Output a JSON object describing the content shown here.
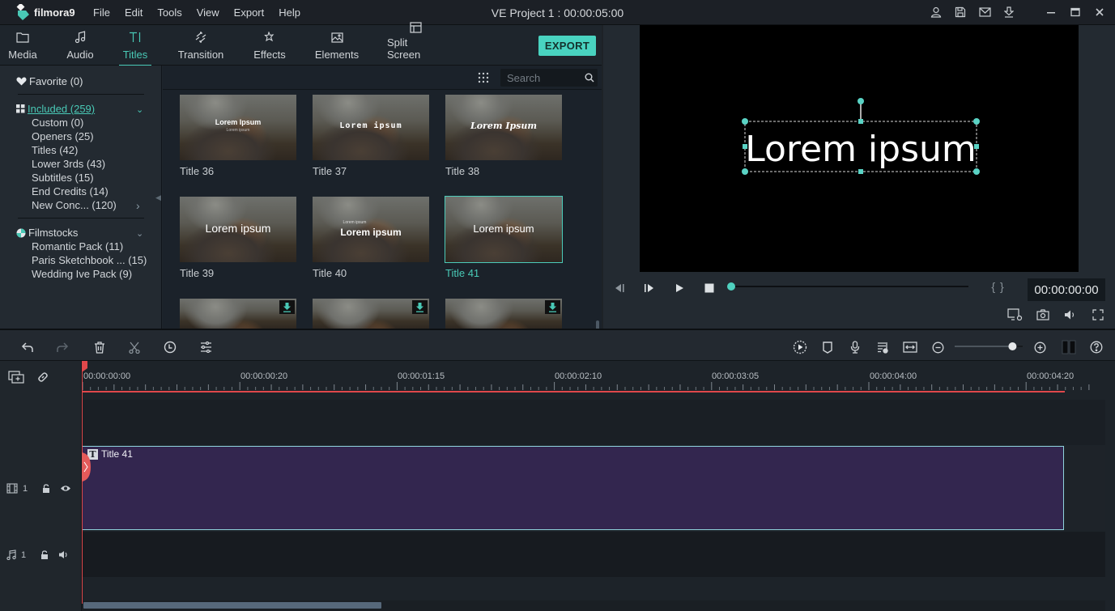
{
  "app": {
    "logo_text": "filmora9",
    "menu": [
      "File",
      "Edit",
      "Tools",
      "View",
      "Export",
      "Help"
    ],
    "project_title": "VE Project 1 : 00:00:05:00",
    "window_icons": [
      "account-icon",
      "save-icon",
      "mail-icon",
      "download-icon",
      "minimize-icon",
      "maximize-icon",
      "close-icon"
    ]
  },
  "tabs": [
    {
      "label": "Media",
      "icon": "folder-icon"
    },
    {
      "label": "Audio",
      "icon": "music-note-icon"
    },
    {
      "label": "Titles",
      "icon": "text-icon",
      "active": true
    },
    {
      "label": "Transition",
      "icon": "transition-icon"
    },
    {
      "label": "Effects",
      "icon": "effects-icon"
    },
    {
      "label": "Elements",
      "icon": "image-icon"
    },
    {
      "label": "Split Screen",
      "icon": "split-screen-icon"
    }
  ],
  "export_label": "EXPORT",
  "sidebar": {
    "favorite": "Favorite (0)",
    "included": {
      "label": "Included (259)",
      "items": [
        "Custom (0)",
        "Openers (25)",
        "Titles (42)",
        "Lower 3rds (43)",
        "Subtitles (15)",
        "End Credits (14)",
        "New Conc... (120)"
      ]
    },
    "filmstocks": {
      "label": "Filmstocks",
      "items": [
        "Romantic Pack (11)",
        "Paris Sketchbook ... (15)",
        "Wedding Ive Pack (9)"
      ]
    }
  },
  "search": {
    "placeholder": "Search",
    "value": ""
  },
  "grid": {
    "items": [
      {
        "label": "Title 36",
        "thumb_text": "Lorem Ipsum",
        "thumb_sub": "Lorem ipsum"
      },
      {
        "label": "Title 37",
        "thumb_text": "Lorem ipsum"
      },
      {
        "label": "Title 38",
        "thumb_text": "Lorem Ipsum"
      },
      {
        "label": "Title 39",
        "thumb_text": "Lorem ipsum"
      },
      {
        "label": "Title 40",
        "thumb_text": "Lorem ipsum",
        "thumb_sub": "Lorem ipsum"
      },
      {
        "label": "Title 41",
        "thumb_text": "Lorem ipsum",
        "selected": true
      },
      {
        "label": "",
        "download": true
      },
      {
        "label": "",
        "download": true
      },
      {
        "label": "",
        "download": true
      }
    ]
  },
  "preview": {
    "canvas_text": "Lorem ipsum",
    "timecode": "00:00:00:00",
    "progress": 0
  },
  "timeline": {
    "ruler_labels": [
      "00:00:00:00",
      "00:00:00:20",
      "00:00:01:15",
      "00:00:02:10",
      "00:00:03:05",
      "00:00:04:00",
      "00:00:04:20"
    ],
    "clip_label": "Title 41",
    "video_track_num": "1",
    "audio_track_num": "1",
    "zoom_level": 0.85
  }
}
